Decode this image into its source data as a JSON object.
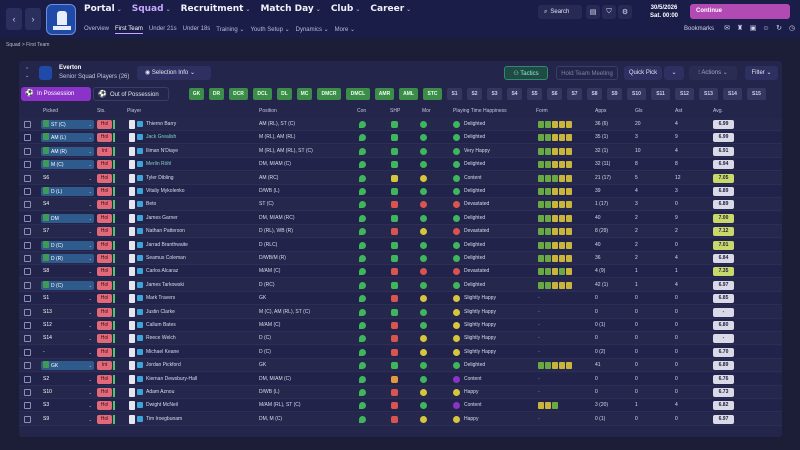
{
  "nav": {
    "main": [
      {
        "label": "Portal",
        "active": false
      },
      {
        "label": "Squad",
        "active": true
      },
      {
        "label": "Recruitment",
        "active": false
      },
      {
        "label": "Match Day",
        "active": false
      },
      {
        "label": "Club",
        "active": false
      },
      {
        "label": "Career",
        "active": false
      }
    ],
    "sub": [
      {
        "label": "Overview",
        "active": false
      },
      {
        "label": "First Team",
        "active": true
      },
      {
        "label": "Under 21s",
        "active": false
      },
      {
        "label": "Under 18s",
        "active": false
      },
      {
        "label": "Training ⌄",
        "active": false
      },
      {
        "label": "Youth Setup ⌄",
        "active": false
      },
      {
        "label": "Dynamics ⌄",
        "active": false
      },
      {
        "label": "More ⌄",
        "active": false
      }
    ],
    "search_label": "Search",
    "date": "30/5/2026",
    "time": "Sat. 00:00",
    "continue_label": "Continue",
    "bookmarks_label": "Bookmarks"
  },
  "breadcrumb": "Squad  >  First Team",
  "team": {
    "name": "Everton",
    "subtitle": "Senior Squad Players (26)",
    "crest_color": "#1f4aa8"
  },
  "toolbar": {
    "selection_info": "Selection Info",
    "tactics": "Tactics",
    "hold_meeting": "Hold Team Meeting",
    "quick_pick": "Quick Pick",
    "actions": "Actions",
    "filter": "Filter"
  },
  "possession": {
    "in": "In Possession",
    "out": "Out of Possession"
  },
  "chips": [
    {
      "label": "GK",
      "on": true
    },
    {
      "label": "DR",
      "on": true
    },
    {
      "label": "DCR",
      "on": true
    },
    {
      "label": "DCL",
      "on": true
    },
    {
      "label": "DL",
      "on": true
    },
    {
      "label": "MC",
      "on": true
    },
    {
      "label": "DMCR",
      "on": true
    },
    {
      "label": "DMCL",
      "on": true
    },
    {
      "label": "AMR",
      "on": true
    },
    {
      "label": "AML",
      "on": true
    },
    {
      "label": "STC",
      "on": true
    },
    {
      "label": "S1",
      "on": false
    },
    {
      "label": "S2",
      "on": false
    },
    {
      "label": "S3",
      "on": false
    },
    {
      "label": "S4",
      "on": false
    },
    {
      "label": "S5",
      "on": false
    },
    {
      "label": "S6",
      "on": false
    },
    {
      "label": "S7",
      "on": false
    },
    {
      "label": "S8",
      "on": false
    },
    {
      "label": "S9",
      "on": false
    },
    {
      "label": "S10",
      "on": false
    },
    {
      "label": "S11",
      "on": false
    },
    {
      "label": "S12",
      "on": false
    },
    {
      "label": "S13",
      "on": false
    },
    {
      "label": "S14",
      "on": false
    },
    {
      "label": "S15",
      "on": false
    }
  ],
  "columns": {
    "picked": "Picked",
    "sts": "Sts.",
    "player": "Player",
    "position": "Position",
    "con": "Con",
    "shp": "SHP",
    "mor": "Mor",
    "pth": "Playing Time Happiness",
    "form": "Form",
    "apps": "Apps",
    "gls": "Gls",
    "ast": "Ast",
    "avg": "Avg."
  },
  "colors": {
    "green": "#3fb65c",
    "yellow": "#d7c53c",
    "red": "#d9544f",
    "orange": "#e39a3a",
    "purple": "#8b33c9",
    "form_green": "#6aa843",
    "form_yellow": "#c9b53b",
    "form_grey": "#6c6e8a"
  },
  "rows": [
    {
      "pick": "ST (C)",
      "sel": true,
      "sts": "Hol",
      "name": "Thierno Barry",
      "pos": "AM (RL), ST (C)",
      "con": "green",
      "shp": "green",
      "mor": "green",
      "hap_c": "green",
      "hap": "Delighted",
      "form": [
        "g",
        "g",
        "y",
        "y",
        "y"
      ],
      "apps": "36 (6)",
      "gls": "20",
      "ast": "4",
      "avg": "6.99",
      "avg_c": "#d9d9e8"
    },
    {
      "pick": "AM (L)",
      "sel": true,
      "sts": "Hol",
      "name": "Jack Grealish",
      "pos": "M (RL), AM (RL)",
      "con": "green",
      "shp": "green",
      "mor": "green",
      "hap_c": "green",
      "hap": "Delighted",
      "form": [
        "g",
        "g",
        "y",
        "y",
        "y"
      ],
      "apps": "35 (1)",
      "gls": "3",
      "ast": "9",
      "avg": "6.99",
      "avg_c": "#d9d9e8"
    },
    {
      "pick": "AM (R)",
      "sel": true,
      "sts": "Int",
      "name": "Iliman N'Diaye",
      "pos": "M (RL), AM (RL), ST (C)",
      "con": "green",
      "shp": "green",
      "mor": "green",
      "hap_c": "green",
      "hap": "Very Happy",
      "form": [
        "g",
        "g",
        "y",
        "y",
        "y"
      ],
      "apps": "32 (1)",
      "gls": "10",
      "ast": "4",
      "avg": "6.91",
      "avg_c": "#d9d9e8"
    },
    {
      "pick": "M (C)",
      "sel": true,
      "sts": "Hol",
      "name": "Merlin Röhl",
      "pos": "DM, M/AM (C)",
      "con": "green",
      "shp": "green",
      "mor": "green",
      "hap_c": "green",
      "hap": "Delighted",
      "form": [
        "g",
        "g",
        "y",
        "y",
        "y"
      ],
      "apps": "32 (11)",
      "gls": "8",
      "ast": "8",
      "avg": "6.94",
      "avg_c": "#d9d9e8"
    },
    {
      "pick": "S6",
      "sel": false,
      "sts": "Hol",
      "name": "Tyler Dibling",
      "pos": "AM (RC)",
      "con": "green",
      "shp": "yellow",
      "mor": "yellow",
      "hap_c": "green",
      "hap": "Content",
      "form": [
        "g",
        "g",
        "g",
        "y",
        "y"
      ],
      "apps": "21 (17)",
      "gls": "5",
      "ast": "12",
      "avg": "7.05",
      "avg_c": "#c9d86a"
    },
    {
      "pick": "D (L)",
      "sel": true,
      "sts": "Hol",
      "name": "Vitaliy Mykolenko",
      "pos": "D/WB (L)",
      "con": "green",
      "shp": "green",
      "mor": "green",
      "hap_c": "green",
      "hap": "Delighted",
      "form": [
        "g",
        "g",
        "y",
        "y",
        "y"
      ],
      "apps": "39",
      "gls": "4",
      "ast": "3",
      "avg": "6.89",
      "avg_c": "#d9d9e8"
    },
    {
      "pick": "S4",
      "sel": false,
      "sts": "Hol",
      "name": "Beto",
      "pos": "ST (C)",
      "con": "green",
      "shp": "red",
      "mor": "red",
      "hap_c": "red",
      "hap": "Devastated",
      "form": [
        "g",
        "g",
        "y",
        "y",
        "y"
      ],
      "apps": "1 (17)",
      "gls": "3",
      "ast": "0",
      "avg": "6.89",
      "avg_c": "#d9d9e8"
    },
    {
      "pick": "DM",
      "sel": true,
      "sts": "Hol",
      "name": "James Garner",
      "pos": "DM, M/AM (RC)",
      "con": "green",
      "shp": "green",
      "mor": "green",
      "hap_c": "green",
      "hap": "Delighted",
      "form": [
        "g",
        "g",
        "y",
        "y",
        "y"
      ],
      "apps": "40",
      "gls": "2",
      "ast": "9",
      "avg": "7.00",
      "avg_c": "#c9d86a"
    },
    {
      "pick": "S7",
      "sel": false,
      "sts": "Hol",
      "name": "Nathan Patterson",
      "pos": "D (RL), WB (R)",
      "con": "green",
      "shp": "red",
      "mor": "yellow",
      "hap_c": "red",
      "hap": "Devastated",
      "form": [
        "g",
        "g",
        "y",
        "y",
        "y"
      ],
      "apps": "8 (29)",
      "gls": "2",
      "ast": "2",
      "avg": "7.12",
      "avg_c": "#c9d86a"
    },
    {
      "pick": "D (C)",
      "sel": true,
      "sts": "Hol",
      "name": "Jarrad Branthwaite",
      "pos": "D (RLC)",
      "con": "green",
      "shp": "green",
      "mor": "green",
      "hap_c": "green",
      "hap": "Delighted",
      "form": [
        "g",
        "g",
        "y",
        "y",
        "y"
      ],
      "apps": "40",
      "gls": "2",
      "ast": "0",
      "avg": "7.01",
      "avg_c": "#c9d86a"
    },
    {
      "pick": "D (R)",
      "sel": true,
      "sts": "Hol",
      "name": "Seamus Coleman",
      "pos": "D/WB/M (R)",
      "con": "green",
      "shp": "green",
      "mor": "green",
      "hap_c": "green",
      "hap": "Delighted",
      "form": [
        "g",
        "g",
        "y",
        "y",
        "y"
      ],
      "apps": "36",
      "gls": "2",
      "ast": "4",
      "avg": "6.84",
      "avg_c": "#d9d9e8"
    },
    {
      "pick": "S8",
      "sel": false,
      "sts": "Hol",
      "name": "Carlos Alcaraz",
      "pos": "M/AM (C)",
      "con": "green",
      "shp": "red",
      "mor": "red",
      "hap_c": "red",
      "hap": "Devastated",
      "form": [
        "g",
        "g",
        "y",
        "g",
        "y"
      ],
      "apps": "4 (9)",
      "gls": "1",
      "ast": "1",
      "avg": "7.35",
      "avg_c": "#c9d86a"
    },
    {
      "pick": "D (C)",
      "sel": true,
      "sts": "Hol",
      "name": "James Tarkowski",
      "pos": "D (RC)",
      "con": "green",
      "shp": "green",
      "mor": "green",
      "hap_c": "green",
      "hap": "Delighted",
      "form": [
        "g",
        "g",
        "y",
        "y",
        "y"
      ],
      "apps": "42 (1)",
      "gls": "1",
      "ast": "4",
      "avg": "6.97",
      "avg_c": "#d9d9e8"
    },
    {
      "pick": "S1",
      "sel": false,
      "sts": "Hol",
      "name": "Mark Travers",
      "pos": "GK",
      "con": "green",
      "shp": "red",
      "mor": "yellow",
      "hap_c": "yellow",
      "hap": "Slightly Happy",
      "form": [
        "-"
      ],
      "apps": "0",
      "gls": "0",
      "ast": "0",
      "avg": "6.85",
      "avg_c": "#d9d9e8"
    },
    {
      "pick": "S13",
      "sel": false,
      "sts": "Hol",
      "name": "Justin Clarke",
      "pos": "M (C), AM (RL), ST (C)",
      "con": "green",
      "shp": "green",
      "mor": "green",
      "hap_c": "yellow",
      "hap": "Slightly Happy",
      "form": [
        "-"
      ],
      "apps": "0",
      "gls": "0",
      "ast": "0",
      "avg": "-",
      "avg_c": "#d9d9e8"
    },
    {
      "pick": "S12",
      "sel": false,
      "sts": "Hol",
      "name": "Callum Bates",
      "pos": "M/AM (C)",
      "con": "green",
      "shp": "red",
      "mor": "green",
      "hap_c": "yellow",
      "hap": "Slightly Happy",
      "form": [
        "-"
      ],
      "apps": "0 (1)",
      "gls": "0",
      "ast": "0",
      "avg": "6.80",
      "avg_c": "#d9d9e8"
    },
    {
      "pick": "S14",
      "sel": false,
      "sts": "Hol",
      "name": "Reece Welch",
      "pos": "D (C)",
      "con": "green",
      "shp": "red",
      "mor": "yellow",
      "hap_c": "yellow",
      "hap": "Slightly Happy",
      "form": [
        "-"
      ],
      "apps": "0",
      "gls": "0",
      "ast": "0",
      "avg": "-",
      "avg_c": "#d9d9e8"
    },
    {
      "pick": "-",
      "sel": false,
      "sts": "Hol",
      "name": "Michael Keane",
      "pos": "D (C)",
      "con": "green",
      "shp": "red",
      "mor": "yellow",
      "hap_c": "yellow",
      "hap": "Slightly Happy",
      "form": [
        "-"
      ],
      "apps": "0 (2)",
      "gls": "0",
      "ast": "0",
      "avg": "6.70",
      "avg_c": "#d9d9e8"
    },
    {
      "pick": "GK",
      "sel": true,
      "sts": "Int",
      "name": "Jordan Pickford",
      "pos": "GK",
      "con": "green",
      "shp": "green",
      "mor": "green",
      "hap_c": "green",
      "hap": "Delighted",
      "form": [
        "g",
        "g",
        "y",
        "y",
        "y"
      ],
      "apps": "41",
      "gls": "0",
      "ast": "0",
      "avg": "6.89",
      "avg_c": "#d9d9e8"
    },
    {
      "pick": "S2",
      "sel": false,
      "sts": "Hol",
      "name": "Kiernan Dewsbury-Hall",
      "pos": "DM, M/AM (C)",
      "con": "green",
      "shp": "orange",
      "mor": "green",
      "hap_c": "purple",
      "hap": "Content",
      "form": [
        "-"
      ],
      "apps": "0",
      "gls": "0",
      "ast": "0",
      "avg": "6.76",
      "avg_c": "#d9d9e8"
    },
    {
      "pick": "S10",
      "sel": false,
      "sts": "Hol",
      "name": "Adam Aznou",
      "pos": "D/WB (L)",
      "con": "green",
      "shp": "red",
      "mor": "yellow",
      "hap_c": "yellow",
      "hap": "Happy",
      "form": [
        "-"
      ],
      "apps": "0",
      "gls": "0",
      "ast": "0",
      "avg": "6.73",
      "avg_c": "#d9d9e8"
    },
    {
      "pick": "S3",
      "sel": false,
      "sts": "Hol",
      "name": "Dwight McNeil",
      "pos": "M/AM (RL), ST (C)",
      "con": "green",
      "shp": "red",
      "mor": "green",
      "hap_c": "purple",
      "hap": "Content",
      "form": [
        "y",
        "y",
        "g"
      ],
      "apps": "3 (20)",
      "gls": "1",
      "ast": "4",
      "avg": "6.82",
      "avg_c": "#d9d9e8"
    },
    {
      "pick": "S9",
      "sel": false,
      "sts": "Hol",
      "name": "Tim Iroegbunam",
      "pos": "DM, M (C)",
      "con": "green",
      "shp": "red",
      "mor": "yellow",
      "hap_c": "yellow",
      "hap": "Happy",
      "form": [
        "-"
      ],
      "apps": "0 (1)",
      "gls": "0",
      "ast": "0",
      "avg": "6.97",
      "avg_c": "#d9d9e8"
    }
  ]
}
